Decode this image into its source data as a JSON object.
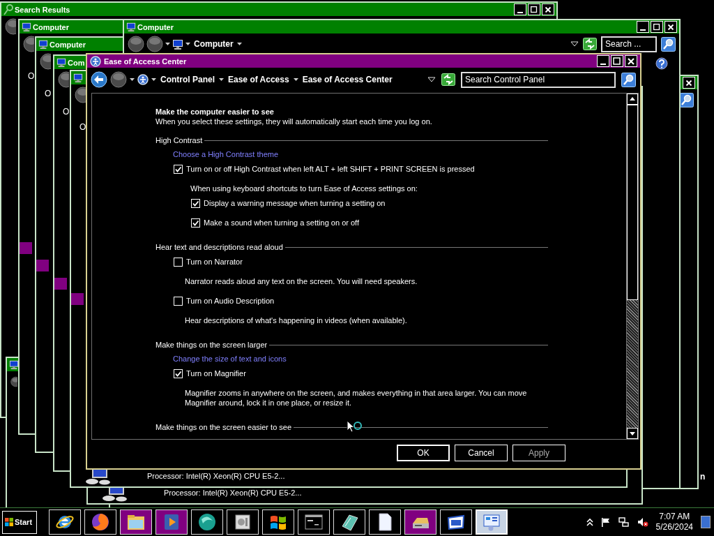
{
  "background_windows": [
    {
      "kind": "search",
      "title": "Search Results",
      "minimize": true,
      "maximize": true,
      "close": true
    },
    {
      "kind": "computer"
    },
    {
      "kind": "plain",
      "close": true,
      "search_button": true
    },
    {
      "kind": "computer",
      "title": "Computer",
      "content": [
        {
          "kind": "label",
          "text": "O"
        },
        {
          "kind": "tile"
        }
      ]
    },
    {
      "kind": "computer",
      "title": "Computer",
      "content": [
        {
          "kind": "label",
          "text": "O"
        },
        {
          "kind": "tile"
        }
      ]
    },
    {
      "kind": "computer",
      "title": "Computer",
      "minimize": true,
      "maximize": true,
      "close": true,
      "address": "Computer",
      "search": {
        "placeholder": "Search ..."
      },
      "help": true
    },
    {
      "kind": "computer",
      "title": "Com",
      "content": [
        {
          "kind": "label",
          "text": "O"
        },
        {
          "kind": "tile"
        }
      ]
    },
    {
      "kind": "computer",
      "content": [
        {
          "kind": "label",
          "text": "O"
        },
        {
          "kind": "tile"
        }
      ],
      "processor": "Processor: Intel(R) Xeon(R) CPU E5-2..."
    },
    {
      "kind": "plain",
      "processor": "Processor: Intel(R) Xeon(R) CPU E5-2..."
    }
  ],
  "background_text": "n",
  "dialog": {
    "title": "Ease of Access Center",
    "breadcrumb": [
      "Control Panel",
      "Ease of Access",
      "Ease of Access Center"
    ],
    "search": {
      "placeholder": "Search Control Panel"
    },
    "heading": "Make the computer easier to see",
    "subtitle": "When you select these settings, they will automatically start each time you log on.",
    "sections": [
      {
        "title": "High Contrast",
        "items": [
          {
            "kind": "link",
            "text": "Choose a High Contrast theme"
          },
          {
            "kind": "checkbox",
            "text": "Turn on or off High Contrast when left ALT + left SHIFT + PRINT SCREEN is pressed",
            "checked": true
          },
          {
            "kind": "note",
            "text": "When using keyboard shortcuts to turn Ease of Access settings on:",
            "children": [
              {
                "kind": "checkbox",
                "text": "Display a warning message when turning a setting on",
                "checked": true
              },
              {
                "kind": "checkbox",
                "text": "Make a sound when turning a setting on or off",
                "checked": true
              }
            ]
          }
        ]
      },
      {
        "title": "Hear text and descriptions read aloud",
        "items": [
          {
            "kind": "checkbox",
            "text": "Turn on Narrator",
            "checked": false
          },
          {
            "kind": "description",
            "text": "Narrator reads aloud any text on the screen. You will need speakers."
          },
          {
            "kind": "checkbox",
            "text": "Turn on Audio Description",
            "checked": false
          },
          {
            "kind": "description",
            "text": "Hear descriptions of what's happening in videos (when available)."
          }
        ]
      },
      {
        "title": "Make things on the screen larger",
        "items": [
          {
            "kind": "link",
            "text": "Change the size of text and icons"
          },
          {
            "kind": "checkbox",
            "text": "Turn on Magnifier",
            "checked": true
          },
          {
            "kind": "description",
            "text": "Magnifier zooms in anywhere on the screen, and makes everything in that area larger. You can move Magnifier around, lock it in one place, or resize it."
          }
        ]
      },
      {
        "title": "Make things on the screen easier to see"
      }
    ],
    "buttons": [
      {
        "label": "OK",
        "default": true,
        "disabled": false
      },
      {
        "label": "Cancel",
        "default": false,
        "disabled": false
      },
      {
        "label": "Apply",
        "default": false,
        "disabled": true
      }
    ]
  },
  "taskbar": {
    "start": "Start",
    "items": [
      {
        "kind": "globe",
        "color": "#000000",
        "selected": false
      },
      {
        "kind": "fox",
        "color": "#000000",
        "selected": false
      },
      {
        "kind": "folder",
        "color": "#800080",
        "selected": false
      },
      {
        "kind": "play",
        "color": "#800080",
        "selected": false
      },
      {
        "kind": "orb",
        "color": "#000000",
        "selected": false
      },
      {
        "kind": "device",
        "color": "#000000",
        "selected": false
      },
      {
        "kind": "flag",
        "color": "#000000",
        "selected": false
      },
      {
        "kind": "console",
        "color": "#000000",
        "selected": false
      },
      {
        "kind": "notebook",
        "color": "#000000",
        "selected": false
      },
      {
        "kind": "document",
        "color": "#000000",
        "selected": false
      },
      {
        "kind": "drive",
        "color": "#800080",
        "selected": false
      },
      {
        "kind": "window",
        "color": "#000000",
        "selected": false
      },
      {
        "kind": "panel",
        "color": "#c8d4e4",
        "selected": true
      }
    ],
    "time": "7:07 AM",
    "date": "5/26/2024"
  }
}
